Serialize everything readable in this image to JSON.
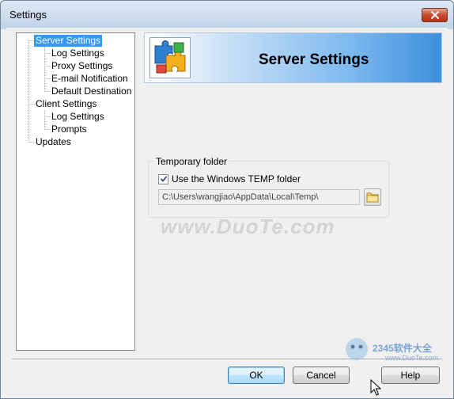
{
  "window": {
    "title": "Settings",
    "close_label": "×"
  },
  "tree": {
    "items": [
      {
        "label": "Server Settings",
        "level": 0,
        "selected": true
      },
      {
        "label": "Log Settings",
        "level": 1
      },
      {
        "label": "Proxy Settings",
        "level": 1
      },
      {
        "label": "E-mail Notification",
        "level": 1
      },
      {
        "label": "Default Destination",
        "level": 1
      },
      {
        "label": "Client Settings",
        "level": 0
      },
      {
        "label": "Log Settings",
        "level": 1
      },
      {
        "label": "Prompts",
        "level": 1
      },
      {
        "label": "Updates",
        "level": 0
      }
    ]
  },
  "banner": {
    "title": "Server Settings",
    "icon": "puzzle-icon"
  },
  "temp_group": {
    "legend": "Temporary folder",
    "use_windows_temp_label": "Use the Windows TEMP folder",
    "use_windows_temp_checked": true,
    "path_value": "C:\\Users\\wangjiao\\AppData\\Local\\Temp\\",
    "browse_icon": "folder-icon"
  },
  "buttons": {
    "ok": "OK",
    "cancel": "Cancel",
    "help": "Help"
  },
  "watermark": {
    "site_text": "www.DuoTe.com",
    "logo_text": "2345软件大全",
    "logo_url": "www.DuoTe.com"
  },
  "colors": {
    "selection": "#3399ff",
    "banner_end": "#3d8fdc",
    "close_button": "#c74a2f"
  }
}
